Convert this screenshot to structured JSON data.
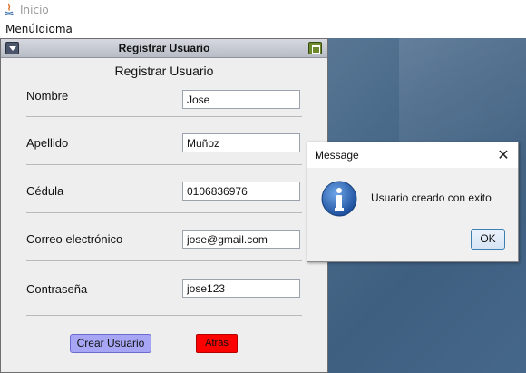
{
  "window": {
    "title": "Inicio"
  },
  "menu": {
    "items": [
      "Menú",
      "Idioma"
    ]
  },
  "internal_frame": {
    "title": "Registrar Usuario",
    "heading": "Registrar Usuario",
    "fields": [
      {
        "label": "Nombre",
        "value": "Jose"
      },
      {
        "label": "Apellido",
        "value": "Muñoz"
      },
      {
        "label": "Cédula",
        "value": "0106836976"
      },
      {
        "label": "Correo electrónico",
        "value": "jose@gmail.com"
      },
      {
        "label": "Contraseña",
        "value": "jose123"
      }
    ],
    "buttons": {
      "crear": "Crear Usuario",
      "atras": "Atrás"
    },
    "colors": {
      "crear_button": "#a6a6f4",
      "atras_button": "#ff0000"
    }
  },
  "dialog": {
    "title": "Message",
    "close_icon": "close-icon",
    "icon": "info-icon",
    "message": "Usuario creado con exito",
    "ok_label": "OK"
  }
}
